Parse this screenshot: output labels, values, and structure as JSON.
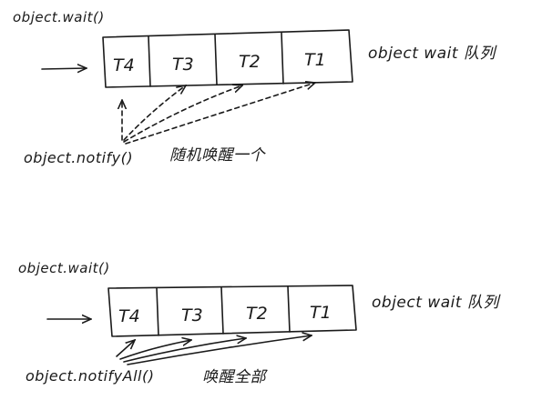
{
  "panels": [
    {
      "title": "object.wait()",
      "cells": [
        "T4",
        "T3",
        "T2",
        "T1"
      ],
      "queue_label": "object wait 队列",
      "call_label": "object.notify()",
      "note": "随机唤醒一个",
      "arrow_style": "dashed"
    },
    {
      "title": "object.wait()",
      "cells": [
        "T4",
        "T3",
        "T2",
        "T1"
      ],
      "queue_label": "object wait 队列",
      "call_label": "object.notifyAll()",
      "note": "唤醒全部",
      "arrow_style": "solid"
    }
  ],
  "colors": {
    "ink": "#1a1a1a",
    "paper": "#ffffff"
  }
}
